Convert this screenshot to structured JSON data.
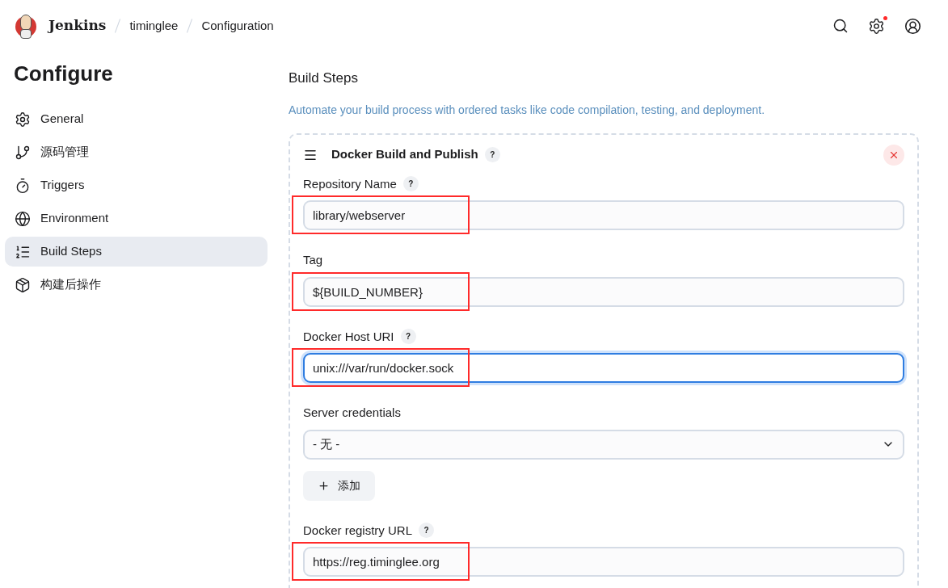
{
  "header": {
    "brand": "Jenkins",
    "breadcrumbs": [
      "timinglee",
      "Configuration"
    ],
    "settings_alert": true
  },
  "sidebar": {
    "title": "Configure",
    "items": [
      {
        "label": "General",
        "selected": false
      },
      {
        "label": "源码管理",
        "selected": false
      },
      {
        "label": "Triggers",
        "selected": false
      },
      {
        "label": "Environment",
        "selected": false
      },
      {
        "label": "Build Steps",
        "selected": true
      },
      {
        "label": "构建后操作",
        "selected": false
      }
    ]
  },
  "section": {
    "title": "Build Steps",
    "description": "Automate your build process with ordered tasks like code compilation, testing, and deployment."
  },
  "step": {
    "title": "Docker Build and Publish",
    "help": "?",
    "fields": [
      {
        "kind": "text",
        "label": "Repository Name",
        "help": "?",
        "value": "library/webserver",
        "focused": false,
        "annotated": true
      },
      {
        "kind": "text",
        "label": "Tag",
        "value": "${BUILD_NUMBER}",
        "focused": false,
        "annotated": true
      },
      {
        "kind": "text",
        "label": "Docker Host URI",
        "help": "?",
        "value": "unix:///var/run/docker.sock",
        "focused": true,
        "annotated": true
      },
      {
        "kind": "select",
        "label": "Server credentials",
        "value": "- 无 -",
        "button": "添加"
      },
      {
        "kind": "text",
        "label": "Docker registry URL",
        "help": "?",
        "value": "https://reg.timinglee.org",
        "focused": false,
        "annotated": true
      }
    ]
  }
}
